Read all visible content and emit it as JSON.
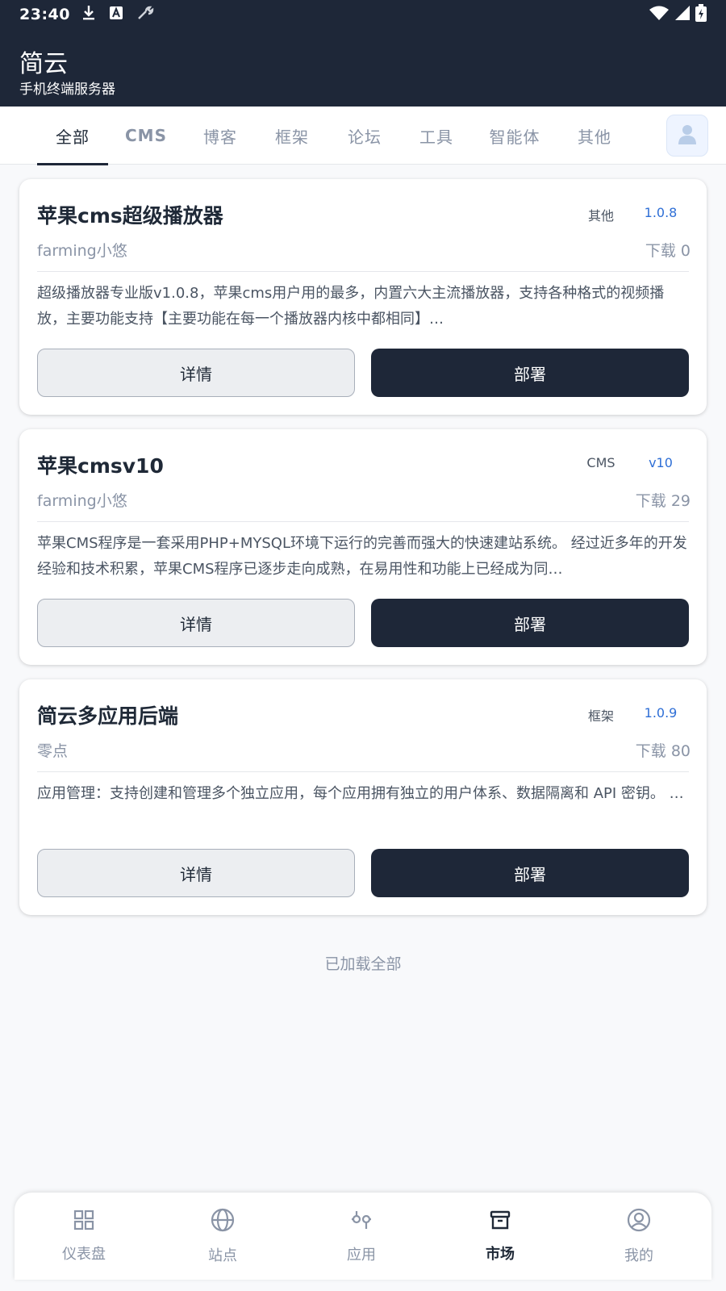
{
  "status_bar": {
    "time": "23:40",
    "icons_left": [
      "download-icon",
      "font-a-icon",
      "wrench-icon"
    ],
    "icons_right": [
      "wifi-icon",
      "signal-icon",
      "battery-charging-icon"
    ]
  },
  "header": {
    "title": "简云",
    "subtitle": "手机终端服务器"
  },
  "tabs": [
    {
      "label": "全部",
      "active": true
    },
    {
      "label": "CMS",
      "active": false
    },
    {
      "label": "博客",
      "active": false
    },
    {
      "label": "框架",
      "active": false
    },
    {
      "label": "论坛",
      "active": false
    },
    {
      "label": "工具",
      "active": false
    },
    {
      "label": "智能体",
      "active": false
    },
    {
      "label": "其他",
      "active": false
    }
  ],
  "apps": [
    {
      "title": "苹果cms超级播放器",
      "tag": "其他",
      "version": "1.0.8",
      "author": "farming小悠",
      "downloads": "下载 0",
      "description": "超级播放器专业版v1.0.8，苹果cms用户用的最多，内置六大主流播放器，支持各种格式的视频播放，主要功能支持【主要功能在每一个播放器内核中都相同】…",
      "detail_label": "详情",
      "deploy_label": "部署"
    },
    {
      "title": "苹果cmsv10",
      "tag": "CMS",
      "version": "v10",
      "author": "farming小悠",
      "downloads": "下载 29",
      "description": "苹果CMS程序是一套采用PHP+MYSQL环境下运行的完善而强大的快速建站系统。 经过近多年的开发经验和技术积累，苹果CMS程序已逐步走向成熟，在易用性和功能上已经成为同…",
      "detail_label": "详情",
      "deploy_label": "部署"
    },
    {
      "title": "简云多应用后端",
      "tag": "框架",
      "version": "1.0.9",
      "author": "零点",
      "downloads": "下载 80",
      "description": "应用管理：支持创建和管理多个独立应用，每个应用拥有独立的用户体系、数据隔离和 API 密钥。 …",
      "detail_label": "详情",
      "deploy_label": "部署"
    }
  ],
  "footer_text": "已加载全部",
  "bottom_nav": [
    {
      "label": "仪表盘",
      "icon": "dashboard-icon",
      "active": false
    },
    {
      "label": "站点",
      "icon": "globe-icon",
      "active": false
    },
    {
      "label": "应用",
      "icon": "apps-icon",
      "active": false
    },
    {
      "label": "市场",
      "icon": "store-icon",
      "active": true
    },
    {
      "label": "我的",
      "icon": "profile-icon",
      "active": false
    }
  ],
  "colors": {
    "header_bg": "#1e2738",
    "accent_version": "#2f6fd6",
    "muted_text": "#8a94a6"
  }
}
